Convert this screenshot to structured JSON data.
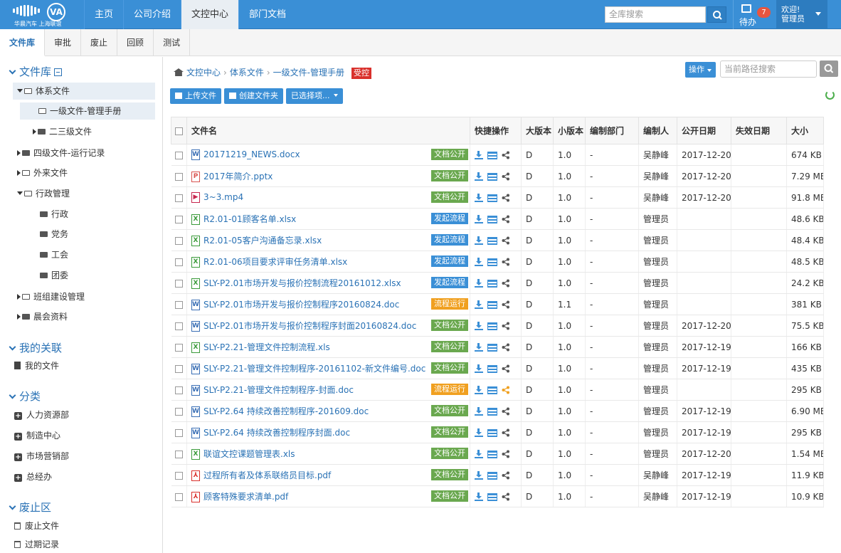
{
  "logo": {
    "caption": "华晨汽车 上海联谊"
  },
  "nav": [
    {
      "label": "主页",
      "active": false
    },
    {
      "label": "公司介绍",
      "active": false
    },
    {
      "label": "文控中心",
      "active": true
    },
    {
      "label": "部门文档",
      "active": false
    }
  ],
  "top_search": {
    "placeholder": "全库搜索"
  },
  "todo": {
    "label": "待办",
    "count": "7"
  },
  "user": {
    "greeting": "欢迎!",
    "name": "管理员"
  },
  "subtabs": [
    {
      "label": "文件库",
      "active": true
    },
    {
      "label": "审批",
      "active": false
    },
    {
      "label": "废止",
      "active": false
    },
    {
      "label": "回顾",
      "active": false
    },
    {
      "label": "测试",
      "active": false
    }
  ],
  "sidebar": {
    "library": {
      "title": "文件库",
      "tree": [
        {
          "label": "体系文件",
          "level": 0,
          "state": "open"
        },
        {
          "label": "一级文件-管理手册",
          "level": 1,
          "state": "leaf-open"
        },
        {
          "label": "二三级文件",
          "level": 1,
          "state": "closed"
        },
        {
          "label": "四级文件-运行记录",
          "level": 0,
          "state": "closed"
        },
        {
          "label": "外来文件",
          "level": 0,
          "state": "hollow"
        },
        {
          "label": "行政管理",
          "level": 0,
          "state": "open"
        },
        {
          "label": "行政",
          "level": 1,
          "state": "leaf"
        },
        {
          "label": "党务",
          "level": 1,
          "state": "leaf"
        },
        {
          "label": "工会",
          "level": 1,
          "state": "leaf"
        },
        {
          "label": "团委",
          "level": 1,
          "state": "leaf"
        },
        {
          "label": "班组建设管理",
          "level": 0,
          "state": "hollow"
        },
        {
          "label": "晨会资料",
          "level": 0,
          "state": "closed"
        }
      ]
    },
    "related": {
      "title": "我的关联",
      "items": [
        "我的文件"
      ]
    },
    "category": {
      "title": "分类",
      "items": [
        "人力资源部",
        "制造中心",
        "市场营销部",
        "总经办"
      ]
    },
    "obsolete": {
      "title": "废止区",
      "items": [
        "废止文件",
        "过期记录"
      ]
    }
  },
  "breadcrumb": {
    "items": [
      "文控中心",
      "体系文件",
      "一级文件-管理手册"
    ],
    "tag": "受控"
  },
  "operate_label": "操作",
  "path_search": {
    "placeholder": "当前路径搜索"
  },
  "actions": {
    "upload": "上传文件",
    "create_folder": "创建文件夹",
    "selected": "已选择项..."
  },
  "table": {
    "headers": [
      "文件名",
      "快捷操作",
      "大版本",
      "小版本",
      "编制部门",
      "编制人",
      "公开日期",
      "失效日期",
      "大小"
    ],
    "status_colors": {
      "文档公开": "#6aa84f",
      "发起流程": "#3a8fd6",
      "流程运行": "#f0a020"
    },
    "rows": [
      {
        "name": "20171219_NEWS.docx",
        "type": "w",
        "status": "文档公开",
        "major": "D",
        "minor": "1.0",
        "dept": "-",
        "author": "吴静峰",
        "pub": "2017-12-20",
        "exp": "",
        "size": "674 KB"
      },
      {
        "name": "2017年简介.pptx",
        "type": "p",
        "status": "文档公开",
        "major": "D",
        "minor": "1.0",
        "dept": "-",
        "author": "吴静峰",
        "pub": "2017-12-20",
        "exp": "",
        "size": "7.29 MB"
      },
      {
        "name": "3~3.mp4",
        "type": "v",
        "status": "文档公开",
        "major": "D",
        "minor": "1.0",
        "dept": "-",
        "author": "吴静峰",
        "pub": "2017-12-20",
        "exp": "",
        "size": "91.8 MB"
      },
      {
        "name": "R2.01-01顾客名单.xlsx",
        "type": "x",
        "status": "发起流程",
        "major": "D",
        "minor": "1.0",
        "dept": "-",
        "author": "管理员",
        "pub": "",
        "exp": "",
        "size": "48.6 KB"
      },
      {
        "name": "R2.01-05客户沟通备忘录.xlsx",
        "type": "x",
        "status": "发起流程",
        "major": "D",
        "minor": "1.0",
        "dept": "-",
        "author": "管理员",
        "pub": "",
        "exp": "",
        "size": "48.4 KB"
      },
      {
        "name": "R2.01-06项目要求评审任务清单.xlsx",
        "type": "x",
        "status": "发起流程",
        "major": "D",
        "minor": "1.0",
        "dept": "-",
        "author": "管理员",
        "pub": "",
        "exp": "",
        "size": "48.5 KB"
      },
      {
        "name": "SLY-P2.01市场开发与报价控制流程20161012.xlsx",
        "type": "x",
        "status": "发起流程",
        "major": "D",
        "minor": "1.0",
        "dept": "-",
        "author": "管理员",
        "pub": "",
        "exp": "",
        "size": "24.2 KB"
      },
      {
        "name": "SLY-P2.01市场开发与报价控制程序20160824.doc",
        "type": "w",
        "status": "流程运行",
        "major": "D",
        "minor": "1.1",
        "dept": "-",
        "author": "管理员",
        "pub": "",
        "exp": "",
        "size": "381 KB"
      },
      {
        "name": "SLY-P2.01市场开发与报价控制程序封面20160824.doc",
        "type": "w",
        "status": "文档公开",
        "major": "D",
        "minor": "1.0",
        "dept": "-",
        "author": "管理员",
        "pub": "2017-12-20",
        "exp": "",
        "size": "75.5 KB"
      },
      {
        "name": "SLY-P2.21-管理文件控制流程.xls",
        "type": "x",
        "status": "文档公开",
        "major": "D",
        "minor": "1.0",
        "dept": "-",
        "author": "管理员",
        "pub": "2017-12-19",
        "exp": "",
        "size": "166 KB"
      },
      {
        "name": "SLY-P2.21-管理文件控制程序-20161102-新文件编号.doc",
        "type": "w",
        "status": "文档公开",
        "major": "D",
        "minor": "1.0",
        "dept": "-",
        "author": "管理员",
        "pub": "2017-12-19",
        "exp": "",
        "size": "435 KB"
      },
      {
        "name": "SLY-P2.21-管理文件控制程序-封面.doc",
        "type": "w",
        "status": "流程运行",
        "major": "D",
        "minor": "1.0",
        "dept": "-",
        "author": "管理员",
        "pub": "",
        "exp": "",
        "size": "295 KB"
      },
      {
        "name": "SLY-P2.64 持续改善控制程序-201609.doc",
        "type": "w",
        "status": "文档公开",
        "major": "D",
        "minor": "1.0",
        "dept": "-",
        "author": "管理员",
        "pub": "2017-12-19",
        "exp": "",
        "size": "6.90 MB"
      },
      {
        "name": "SLY-P2.64 持续改善控制程序封面.doc",
        "type": "w",
        "status": "文档公开",
        "major": "D",
        "minor": "1.0",
        "dept": "-",
        "author": "管理员",
        "pub": "2017-12-19",
        "exp": "",
        "size": "295 KB"
      },
      {
        "name": "联谊文控课题管理表.xls",
        "type": "x",
        "status": "文档公开",
        "major": "D",
        "minor": "1.0",
        "dept": "-",
        "author": "管理员",
        "pub": "2017-12-20",
        "exp": "",
        "size": "1.54 MB"
      },
      {
        "name": "过程所有者及体系联络员目标.pdf",
        "type": "pdf",
        "status": "文档公开",
        "major": "D",
        "minor": "1.0",
        "dept": "-",
        "author": "吴静峰",
        "pub": "2017-12-19",
        "exp": "",
        "size": "11.9 KB"
      },
      {
        "name": "顾客特殊要求清单.pdf",
        "type": "pdf",
        "status": "文档公开",
        "major": "D",
        "minor": "1.0",
        "dept": "-",
        "author": "吴静峰",
        "pub": "2017-12-19",
        "exp": "",
        "size": "10.9 KB"
      }
    ]
  }
}
